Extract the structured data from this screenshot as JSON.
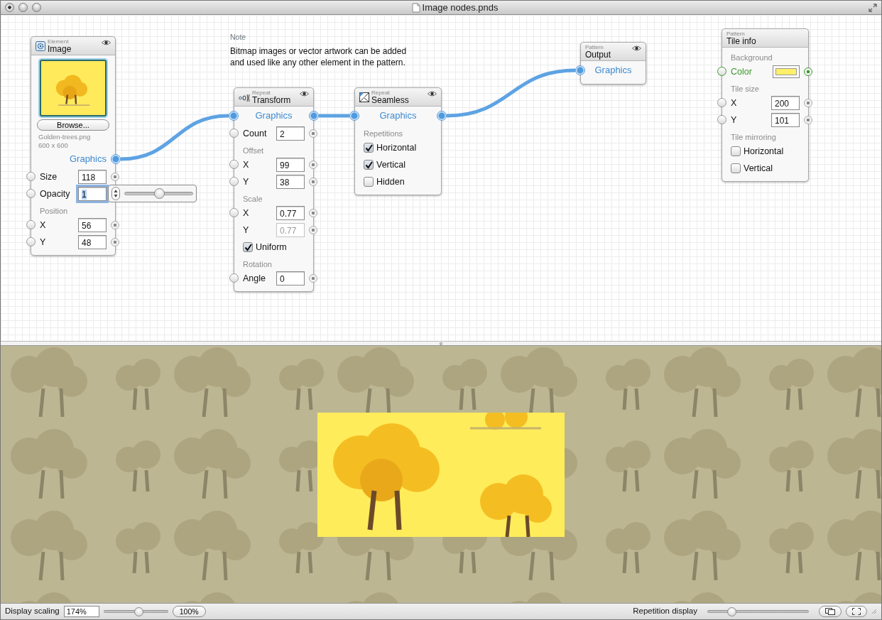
{
  "window": {
    "title": "Image nodes.pnds"
  },
  "note": {
    "heading": "Note",
    "lines": [
      "Bitmap images or vector artwork can be added",
      "and used like any other element in the pattern."
    ]
  },
  "nodes": [
    {
      "kind": "element",
      "category": "Element",
      "title": "Image",
      "eye": true,
      "rows": [
        {
          "kind": "image"
        },
        {
          "kind": "button",
          "label": "Browse..."
        },
        {
          "kind": "info",
          "text": "Golden-trees.png"
        },
        {
          "kind": "info",
          "text": "600 x 600"
        },
        {
          "kind": "port",
          "label": "Graphics",
          "port_in": false,
          "port_out": true
        },
        {
          "kind": "field",
          "label": "Size",
          "value": "118",
          "port_in": true,
          "port_out": true
        },
        {
          "kind": "field",
          "label": "Opacity",
          "value": "1",
          "port_in": true,
          "port_out": false,
          "focused": true,
          "slider": {
            "level": 0.5
          }
        },
        {
          "kind": "section",
          "label": "Position"
        },
        {
          "kind": "field",
          "label": "X",
          "value": "56",
          "port_in": true,
          "port_out": true
        },
        {
          "kind": "field",
          "label": "Y",
          "value": "48",
          "port_in": true,
          "port_out": true
        }
      ]
    },
    {
      "kind": "transform",
      "category": "Repeat",
      "title": "Transform",
      "eye": true,
      "rows": [
        {
          "kind": "port",
          "label": "Graphics",
          "port_in": true,
          "port_out": true
        },
        {
          "kind": "field",
          "label": "Count",
          "value": "2",
          "port_in": true,
          "port_out": true
        },
        {
          "kind": "section",
          "label": "Offset"
        },
        {
          "kind": "field",
          "label": "X",
          "value": "99",
          "port_in": true,
          "port_out": true
        },
        {
          "kind": "field",
          "label": "Y",
          "value": "38",
          "port_in": true,
          "port_out": true
        },
        {
          "kind": "section",
          "label": "Scale"
        },
        {
          "kind": "field",
          "label": "X",
          "value": "0.77",
          "port_in": true,
          "port_out": true
        },
        {
          "kind": "field",
          "label": "Y",
          "value": "0.77",
          "port_in": false,
          "port_out": true,
          "disabled": true
        },
        {
          "kind": "checkbox",
          "label": "Uniform",
          "checked": true
        },
        {
          "kind": "section",
          "label": "Rotation"
        },
        {
          "kind": "field",
          "label": "Angle",
          "value": "0",
          "port_in": true,
          "port_out": true
        }
      ]
    },
    {
      "kind": "seamless",
      "category": "Repeat",
      "title": "Seamless",
      "eye": true,
      "rows": [
        {
          "kind": "port",
          "label": "Graphics",
          "port_in": true,
          "port_out": true
        },
        {
          "kind": "section",
          "label": "Repetitions"
        },
        {
          "kind": "checkbox",
          "label": "Horizontal",
          "checked": true
        },
        {
          "kind": "checkbox",
          "label": "Vertical",
          "checked": true
        },
        {
          "kind": "checkbox",
          "label": "Hidden",
          "checked": false
        }
      ]
    },
    {
      "kind": "output",
      "category": "Pattern",
      "title": "Output",
      "eye": true,
      "rows": [
        {
          "kind": "port",
          "label": "Graphics",
          "port_in": true,
          "port_out": false
        }
      ]
    },
    {
      "kind": "tileinfo",
      "category": "Pattern",
      "title": "Tile info",
      "eye": false,
      "rows": [
        {
          "kind": "section",
          "label": "Background"
        },
        {
          "kind": "color",
          "label": "Color"
        },
        {
          "kind": "section",
          "label": "Tile size"
        },
        {
          "kind": "field",
          "label": "X",
          "value": "200",
          "port_in": true,
          "port_out": true
        },
        {
          "kind": "field",
          "label": "Y",
          "value": "101",
          "port_in": true,
          "port_out": true
        },
        {
          "kind": "section",
          "label": "Tile mirroring"
        },
        {
          "kind": "checkbox",
          "label": "Horizontal",
          "checked": false
        },
        {
          "kind": "checkbox",
          "label": "Vertical",
          "checked": false
        }
      ]
    }
  ],
  "status_bar": {
    "scaling_label": "Display scaling",
    "scaling_value": "174%",
    "scaling_slider": {
      "level": 0.55
    },
    "reset_button": "100%",
    "repetition_label": "Repetition display",
    "repetition_slider": {
      "level": 0.24
    }
  }
}
